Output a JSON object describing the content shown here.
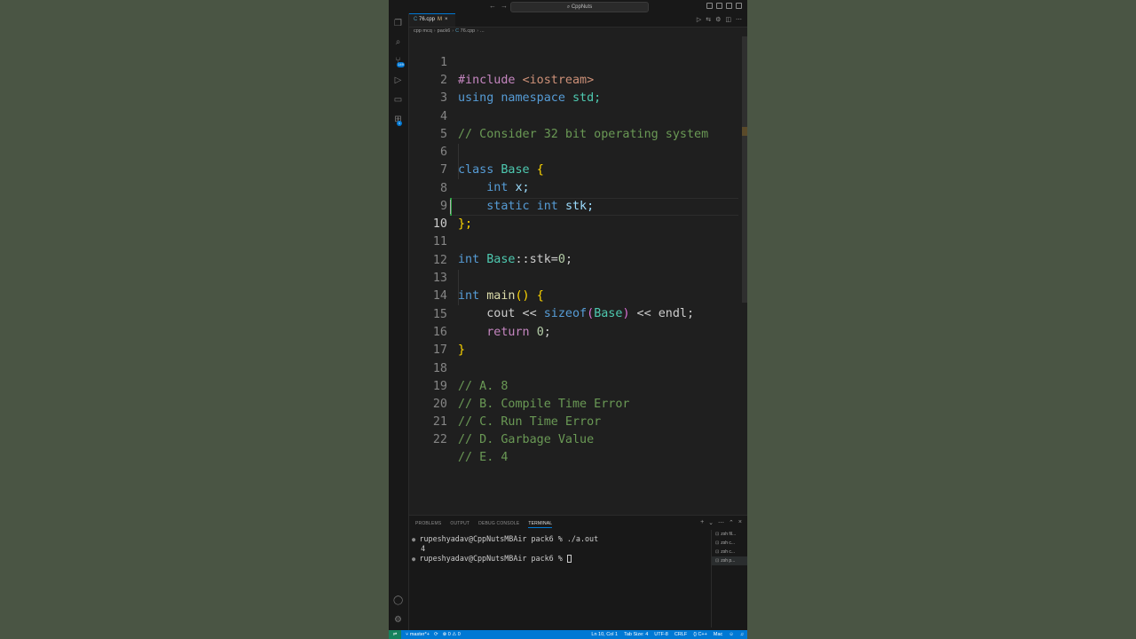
{
  "titlebar": {
    "back_arrow": "←",
    "forward_arrow": "→",
    "search_text": "CppNuts"
  },
  "tab": {
    "filename": "76.cpp",
    "modified": "M",
    "close": "×"
  },
  "breadcrumb": [
    "cpp mcq",
    "pack6",
    "76.cpp",
    "..."
  ],
  "code_lines": [
    {
      "n": "1"
    },
    {
      "n": "2"
    },
    {
      "n": "3"
    },
    {
      "n": "4"
    },
    {
      "n": "5"
    },
    {
      "n": "6"
    },
    {
      "n": "7"
    },
    {
      "n": "8"
    },
    {
      "n": "9"
    },
    {
      "n": "10"
    },
    {
      "n": "11"
    },
    {
      "n": "12"
    },
    {
      "n": "13"
    },
    {
      "n": "14"
    },
    {
      "n": "15"
    },
    {
      "n": "16"
    },
    {
      "n": "17"
    },
    {
      "n": "18"
    },
    {
      "n": "19"
    },
    {
      "n": "20"
    },
    {
      "n": "21"
    },
    {
      "n": "22"
    }
  ],
  "code": {
    "l1_include": "#include",
    "l1_header": "<iostream>",
    "l2_using": "using",
    "l2_namespace": "namespace",
    "l2_std": "std;",
    "l4_comment": "// Consider 32 bit operating system",
    "l6_class": "class",
    "l6_name": "Base",
    "l6_brace": "{",
    "l7_int": "int",
    "l7_x": "x;",
    "l8_static": "static",
    "l8_int": "int",
    "l8_stk": "stk;",
    "l9_close": "};",
    "l11_int": "int",
    "l11_base": "Base",
    "l11_rest": "::stk=",
    "l11_zero": "0",
    "l11_semi": ";",
    "l13_int": "int",
    "l13_main": "main",
    "l13_parens": "()",
    "l13_brace": "{",
    "l14_cout": "cout << ",
    "l14_sizeof": "sizeof",
    "l14_lp": "(",
    "l14_base": "Base",
    "l14_rp": ")",
    "l14_rest": " << endl;",
    "l15_return": "return",
    "l15_zero": "0",
    "l15_semi": ";",
    "l16_close": "}",
    "l18": "// A. 8",
    "l19": "// B. Compile Time Error",
    "l20": "// C. Run Time Error",
    "l21": "// D. Garbage Value",
    "l22": "// E. 4"
  },
  "panel": {
    "tabs": [
      "PROBLEMS",
      "OUTPUT",
      "DEBUG CONSOLE",
      "TERMINAL"
    ],
    "terminal_lines": [
      "rupeshyadav@CppNutsMBAir pack6 % ./a.out",
      "4",
      "rupeshyadav@CppNutsMBAir pack6 % "
    ],
    "terminals": [
      "zsh  fil...",
      "zsh  c...",
      "zsh  c...",
      "zsh  p..."
    ]
  },
  "statusbar": {
    "branch": "master*+",
    "problems": "⊗ 0 ⚠ 0",
    "position": "Ln 10, Col 1",
    "tabsize": "Tab Size: 4",
    "encoding": "UTF-8",
    "eol": "CRLF",
    "language": "{} C++",
    "platform": "Mac"
  },
  "colors": {
    "accent": "#0078d4",
    "remote": "#16825d",
    "editor_bg": "#1f1f1f"
  }
}
